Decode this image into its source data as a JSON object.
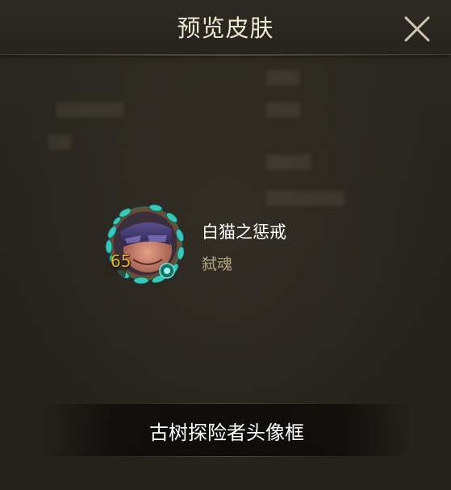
{
  "dialog": {
    "title": "预览皮肤",
    "close_icon": "close-icon"
  },
  "skin": {
    "level": "65",
    "name": "白猫之惩戒",
    "subtitle": "弑魂",
    "frame_icon": "ancient-tree-avatar-frame"
  },
  "footer": {
    "frame_name": "古树探险者头像框"
  },
  "colors": {
    "title": "#efe6cf",
    "level": "#f0b320",
    "subtitle": "#b3a27e",
    "frame_leaf": "#34c9b8"
  }
}
